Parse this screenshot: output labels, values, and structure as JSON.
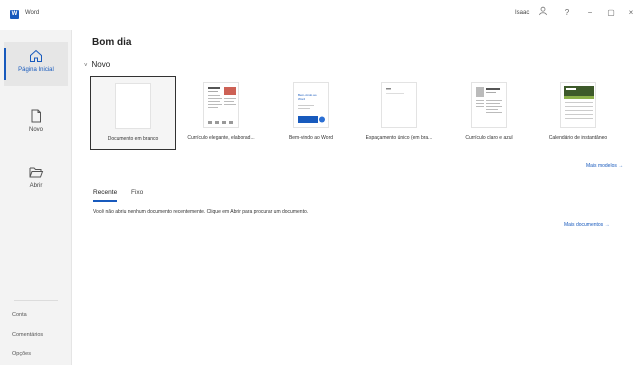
{
  "window": {
    "app_title": "Word",
    "logo_letter": "W",
    "user_name": "Isaac",
    "help": "?",
    "minimize": "−",
    "maximize": "▢",
    "close": "×"
  },
  "sidebar": {
    "items": [
      {
        "label": "Página Inicial",
        "icon": "home-icon",
        "active": true
      },
      {
        "label": "Novo",
        "icon": "new-document-icon"
      },
      {
        "label": "Abrir",
        "icon": "folder-open-icon"
      }
    ],
    "bottom": [
      "Conta",
      "Comentários",
      "Opções"
    ]
  },
  "greeting": "Bom dia",
  "new_section": {
    "chevron": "˅",
    "title": "Novo",
    "templates": [
      {
        "label": "Documento em branco"
      },
      {
        "label": "Currículo elegante, elaborad..."
      },
      {
        "label": "Bem-vindo ao Word",
        "thumb_text": "Bem-vindo ao Word"
      },
      {
        "label": "Espaçamento único (em bra..."
      },
      {
        "label": "Currículo claro e azul"
      },
      {
        "label": "Calendário de instantâneo"
      }
    ],
    "more_label": "Mais modelos →"
  },
  "recent": {
    "tabs": [
      "Recente",
      "Fixo"
    ],
    "empty_message": "Você não abriu nenhum documento recentemente. Clique em Abrir para procurar um documento.",
    "more_label": "Mais documentos →"
  },
  "colors": {
    "accent": "#185abd",
    "sidebar_bg": "#f3f3f3"
  }
}
